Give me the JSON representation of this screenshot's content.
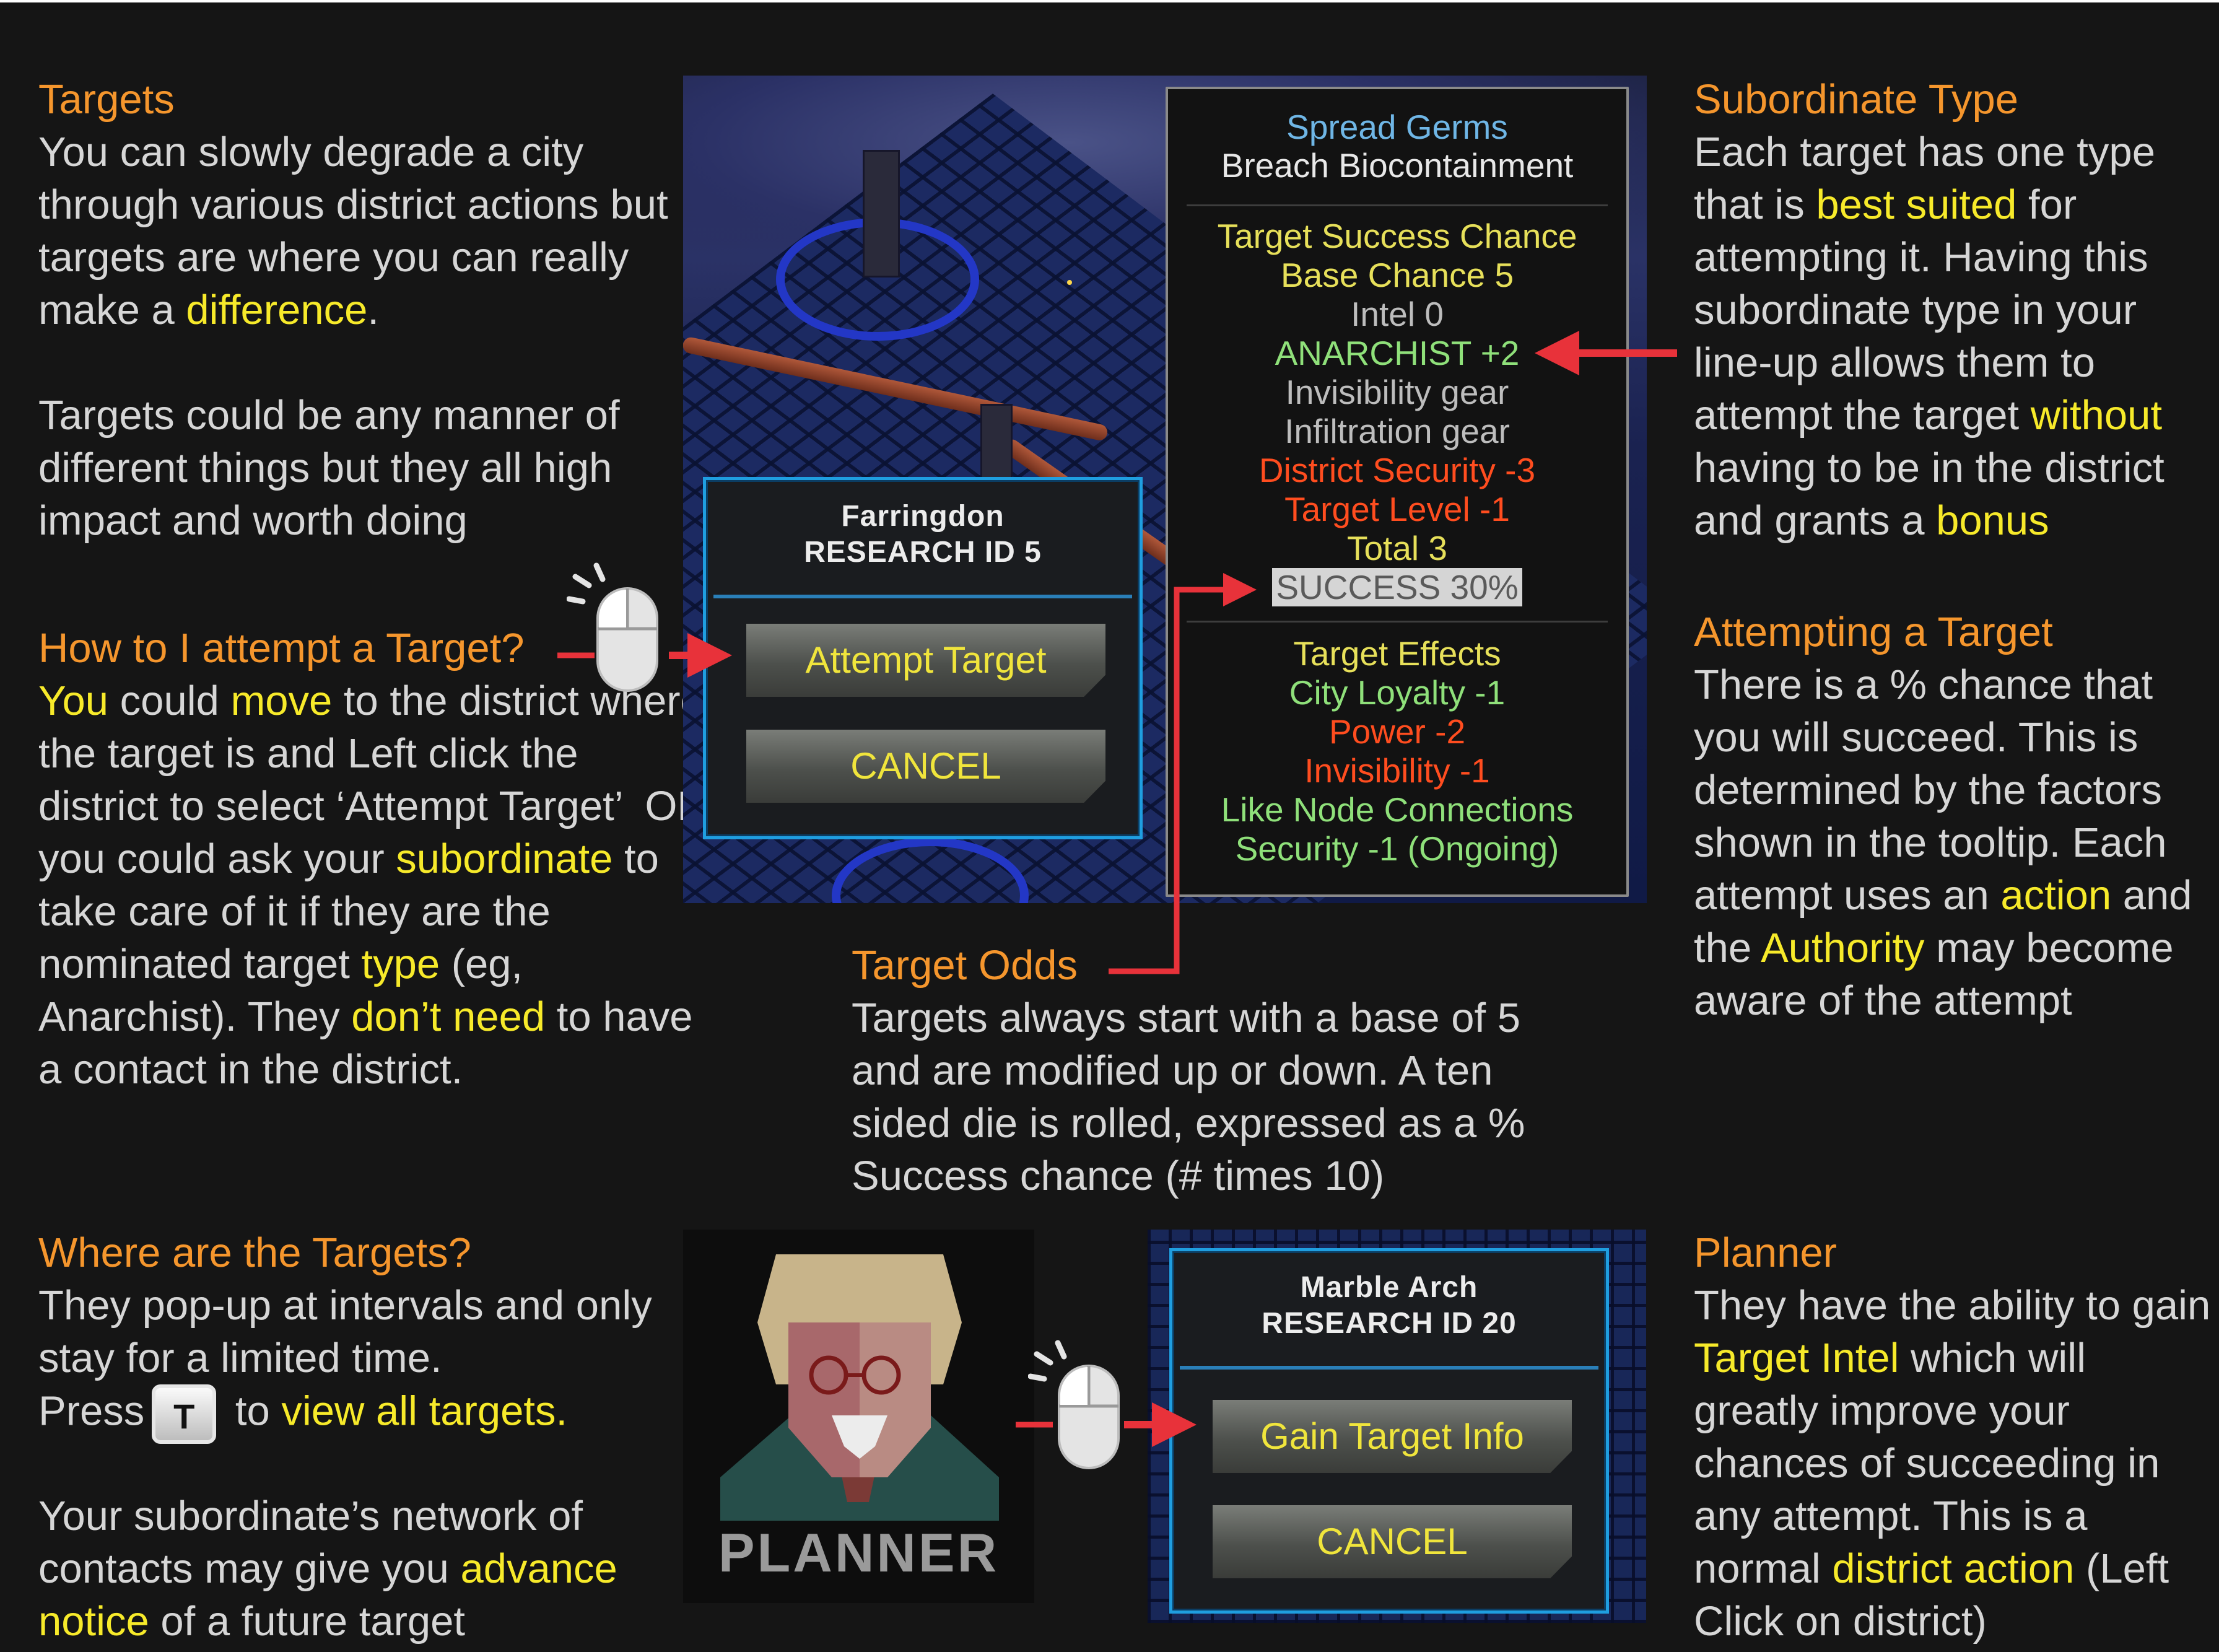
{
  "colors": {
    "background": "#151515",
    "heading": "#f5962d",
    "highlight": "#f7ea2a",
    "body": "#d6d6d6",
    "arrow": "#e8323a",
    "dialog_border": "#1f9ee0"
  },
  "targets": {
    "heading": "Targets",
    "p1_a": "You can slowly degrade a city through various district actions but targets are where you can really make a ",
    "p1_hl": "difference",
    "p1_b": ".",
    "p2": "Targets could be any manner of different things but they all high impact and worth doing"
  },
  "how_to": {
    "heading": "How to I attempt a Target?",
    "hl_you": "You",
    "t1": " could ",
    "hl_move": "move",
    "t2": " to the district where the target is and Left click the district to select ‘Attempt Target’  OR you could ask your ",
    "hl_sub": "subordinate",
    "t3": " to take care of it if they are the nominated target ",
    "hl_type": "type",
    "t4": " (eg, Anarchist). They ",
    "hl_dont": "don’t need",
    "t5": " to have a contact in the district."
  },
  "where": {
    "heading": "Where are the Targets?",
    "t1": "They pop-up at intervals and only stay for a limited time.",
    "press": "Press",
    "key": "T",
    "to": " to ",
    "hl_view": "view all targets.",
    "t2": "Your subordinate’s network of contacts may give you ",
    "hl_adv": "advance notice",
    "t3": " of a future target"
  },
  "subordinate": {
    "heading": "Subordinate Type",
    "t1": "Each target has one type that is ",
    "hl_best": "best suited",
    "t2": " for attempting it. Having this subordinate type in your line-up allows them to attempt the target ",
    "hl_without": "without",
    "t3": " having to be in the district and grants a ",
    "hl_bonus": "bonus"
  },
  "attempting": {
    "heading": "Attempting a Target",
    "t1": "There is a % chance that you will succeed. This is determined by the factors shown in the tooltip. Each attempt uses an ",
    "hl_action": "action",
    "t2": " and the ",
    "hl_authority": "Authority",
    "t3": " may become aware of the attempt"
  },
  "odds": {
    "heading": "Target Odds",
    "text": "Targets always start with a base of 5 and are modified up or down. A ten sided die is rolled, expressed as a % Success chance (# times 10)"
  },
  "planner": {
    "heading": "Planner",
    "t1": "They have the ability to gain ",
    "hl_intel": "Target Intel",
    "t2": " which will greatly improve your chances of succeeding in any attempt. This is a normal ",
    "hl_district": "district action",
    "t3": " (Left Click on district)",
    "portrait_label": "PLANNER"
  },
  "tooltip": {
    "title": "Spread Germs",
    "subtitle": "Breach Biocontainment",
    "success_chance": "Target Success Chance",
    "base": "Base Chance 5",
    "intel": "Intel 0",
    "anarchist": "ANARCHIST +2",
    "invis_gear": "Invisibility gear",
    "infil_gear": "Infiltration gear",
    "district_security": "District Security -3",
    "target_level": "Target Level -1",
    "total": "Total 3",
    "success": "SUCCESS 30%",
    "effects_heading": "Target Effects",
    "effect1": "City Loyalty -1",
    "effect2": "Power -2",
    "effect3": "Invisibility -1",
    "effect4": "Like Node Connections",
    "effect5": "Security -1 (Ongoing)"
  },
  "dialog1": {
    "district": "Farringdon",
    "research": "RESEARCH ID 5",
    "primary": "Attempt Target",
    "cancel": "CANCEL"
  },
  "dialog2": {
    "district": "Marble Arch",
    "research": "RESEARCH ID 20",
    "primary": "Gain Target Info",
    "cancel": "CANCEL"
  }
}
